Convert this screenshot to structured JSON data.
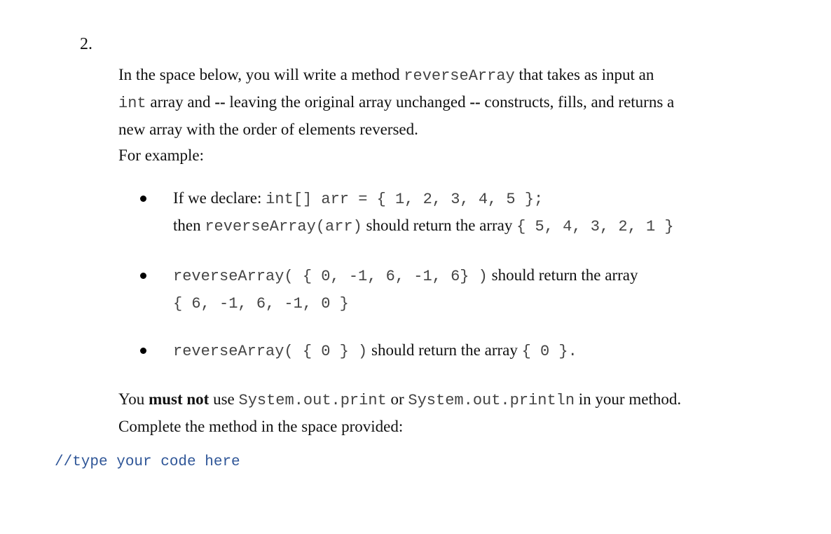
{
  "question_number": "2.",
  "intro": {
    "line1_a": "In the space below, you will write a method ",
    "line1_code": "reverseArray",
    "line1_b": " that takes as input an",
    "line2_code": "int",
    "line2_a": "  array and ",
    "line2_dash1": "--",
    "line2_b": " leaving the original array unchanged ",
    "line2_dash2": "--",
    "line2_c": " constructs, fills, and returns a",
    "line3": "new array with the order of elements reversed.",
    "line4": "For example:"
  },
  "examples": [
    {
      "line1_text": "If we declare: ",
      "line1_code": "int[] arr = { 1, 2, 3, 4, 5 };",
      "line2_text_a": "then ",
      "line2_code": "reverseArray(arr)",
      "line2_text_b": " should return the array ",
      "line2_result": "{ 5, 4, 3, 2, 1 }"
    },
    {
      "line1_code": "reverseArray( { 0, -1, 6, -1, 6} )",
      "line1_text": " should return the array",
      "line2_result": "{ 6, -1, 6, -1, 0 }"
    },
    {
      "line1_code": "reverseArray( { 0 } )",
      "line1_text": " should return the array ",
      "line1_result": "{ 0 }."
    }
  ],
  "instructions": {
    "line1_a": "You ",
    "line1_bold": "must not",
    "line1_b": " use ",
    "line1_code1": "System.out.print",
    "line1_c": " or ",
    "line1_code2": "System.out.println",
    "line1_d": " in your method.",
    "line2": "Complete the method in the space provided:"
  },
  "code_area": {
    "placeholder_comment": "//type your code here"
  }
}
